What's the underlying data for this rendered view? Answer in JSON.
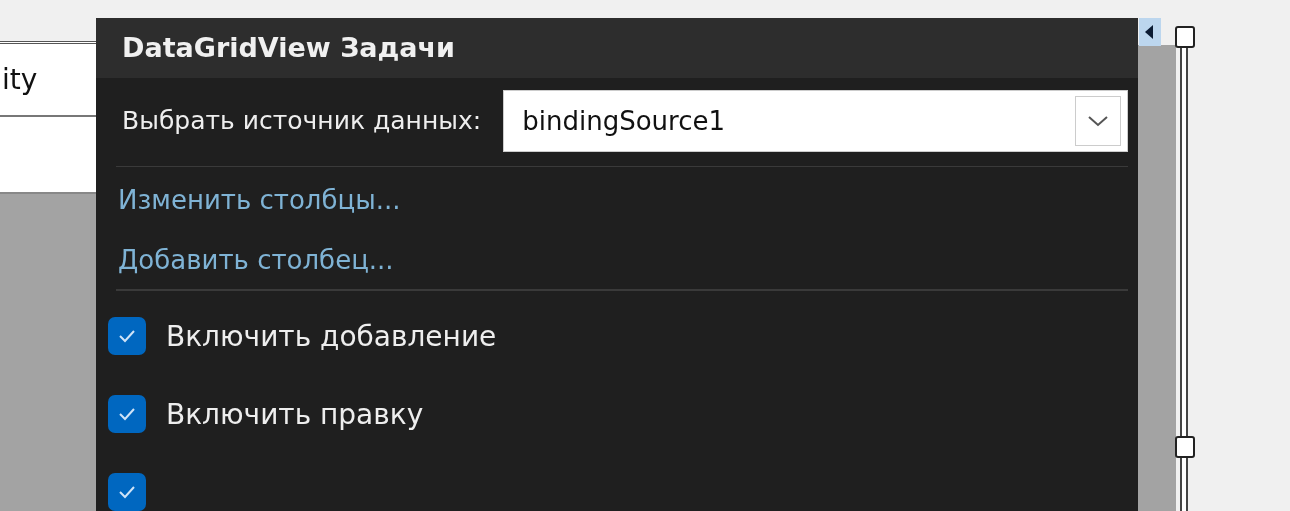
{
  "grid_header": {
    "text": "ity"
  },
  "panel": {
    "title": "DataGridView Задачи",
    "data_source": {
      "label": "Выбрать источник данных:",
      "value": "bindingSource1"
    },
    "links": [
      "Изменить столбцы...",
      "Добавить столбец..."
    ],
    "options": [
      {
        "label": "Включить добавление",
        "checked": true
      },
      {
        "label": "Включить правку",
        "checked": true
      },
      {
        "checked": true
      }
    ]
  }
}
